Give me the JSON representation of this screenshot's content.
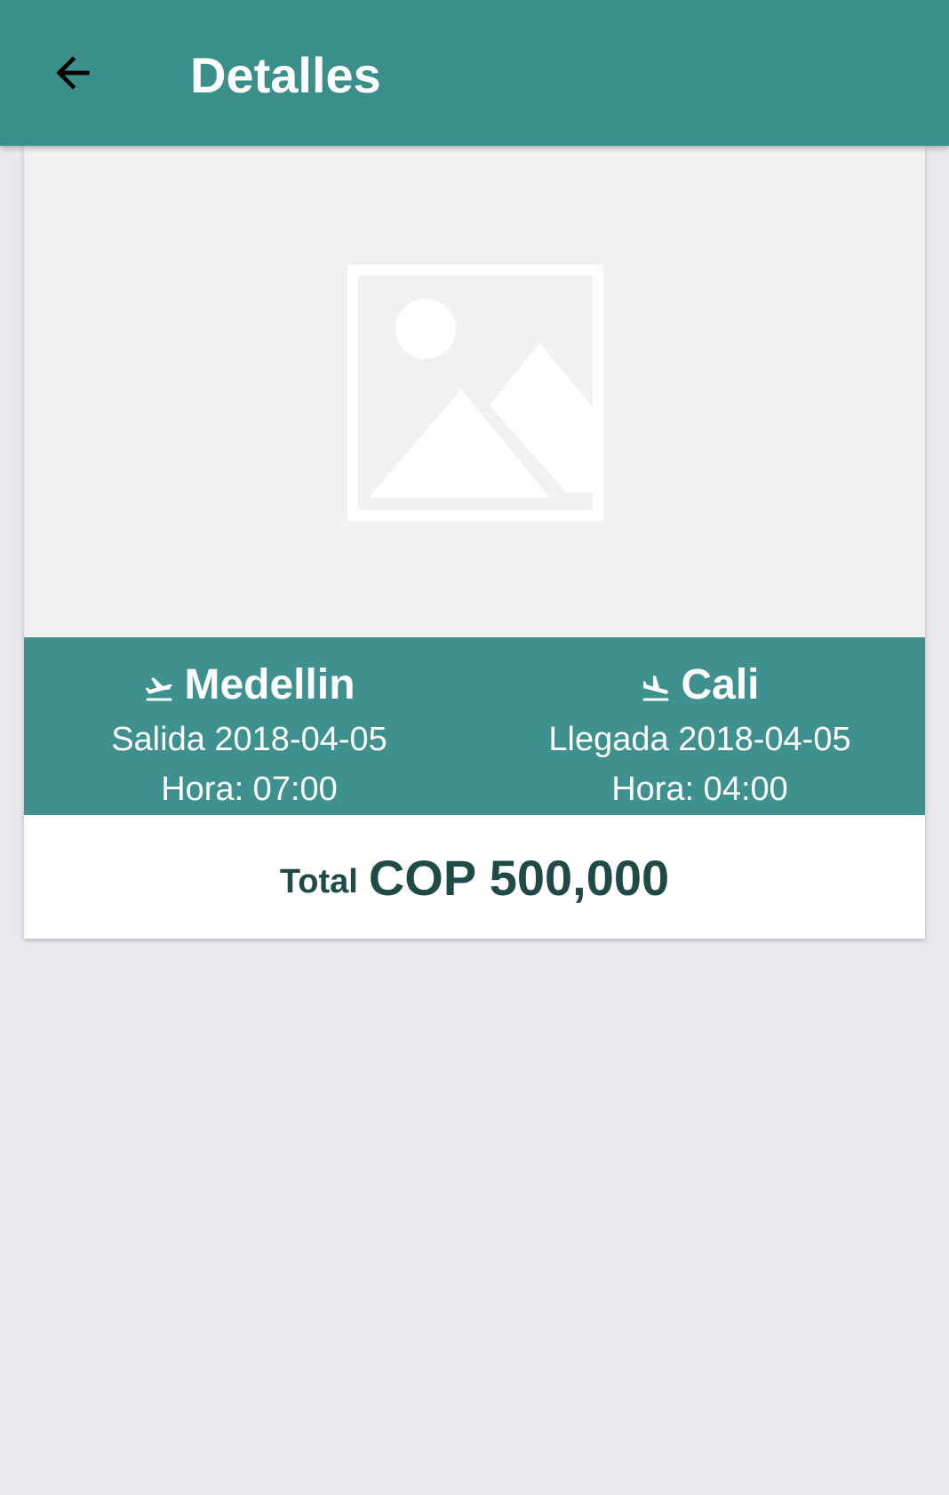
{
  "app_bar": {
    "title": "Detalles",
    "back_icon": "arrow-back-icon"
  },
  "card": {
    "image": {
      "icon": "image-placeholder-icon"
    },
    "departure": {
      "icon": "flight-takeoff-icon",
      "city": "Medellin",
      "date_text": "Salida 2018-04-05",
      "time_text": "Hora: 07:00"
    },
    "arrival": {
      "icon": "flight-land-icon",
      "city": "Cali",
      "date_text": "Llegada 2018-04-05",
      "time_text": "Hora: 04:00"
    },
    "total": {
      "label": "Total",
      "amount": "COP 500,000"
    }
  },
  "colors": {
    "app_bar": "#3b8f8b",
    "route_band": "#3e918e",
    "total_text": "#1f4a48",
    "background": "#e9e8ed"
  }
}
